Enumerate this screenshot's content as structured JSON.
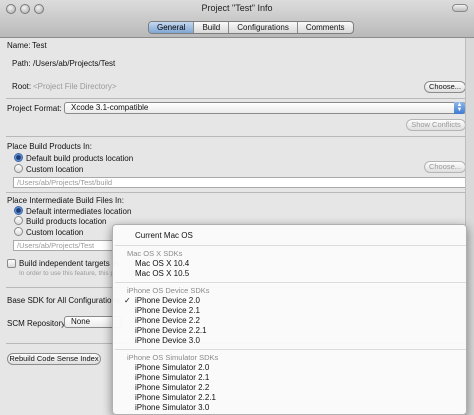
{
  "window": {
    "title": "Project \"Test\" Info",
    "tabs": [
      {
        "label": "General",
        "active": true
      },
      {
        "label": "Build",
        "active": false
      },
      {
        "label": "Configurations",
        "active": false
      },
      {
        "label": "Comments",
        "active": false
      }
    ]
  },
  "general": {
    "name_label": "Name:",
    "name_value": "Test",
    "path_label": "Path:",
    "path_value": "/Users/ab/Projects/Test",
    "root_label": "Root:",
    "root_placeholder": "<Project File Directory>",
    "choose_label": "Choose...",
    "format_label": "Project Format:",
    "format_value": "Xcode 3.1-compatible",
    "show_conflicts_label": "Show Conflicts"
  },
  "build_products": {
    "heading": "Place Build Products In:",
    "default_label": "Default build products location",
    "custom_label": "Custom location",
    "choose_label": "Choose...",
    "path_value": "/Users/ab/Projects/Test/build"
  },
  "intermediates": {
    "heading": "Place Intermediate Build Files In:",
    "default_label": "Default intermediates location",
    "build_products_label": "Build products location",
    "custom_label": "Custom location",
    "path_value": "/Users/ab/Projects/Test",
    "independent_label": "Build independent targets in",
    "independent_note": "In order to use this feature, this p"
  },
  "sdk": {
    "base_label": "Base SDK for All Configurations:",
    "scm_label": "SCM Repository:",
    "scm_value": "None",
    "rebuild_label": "Rebuild Code Sense Index"
  },
  "sdk_menu": {
    "items": [
      {
        "label": "Current Mac OS",
        "type": "item"
      },
      {
        "label": "Mac OS X SDKs",
        "type": "header"
      },
      {
        "label": "Mac OS X 10.4",
        "type": "item"
      },
      {
        "label": "Mac OS X 10.5",
        "type": "item"
      },
      {
        "label": "iPhone OS Device SDKs",
        "type": "header"
      },
      {
        "label": "iPhone Device 2.0",
        "type": "item",
        "checked": true
      },
      {
        "label": "iPhone Device 2.1",
        "type": "item"
      },
      {
        "label": "iPhone Device 2.2",
        "type": "item"
      },
      {
        "label": "iPhone Device 2.2.1",
        "type": "item"
      },
      {
        "label": "iPhone Device 3.0",
        "type": "item"
      },
      {
        "label": "iPhone OS Simulator SDKs",
        "type": "header"
      },
      {
        "label": "iPhone Simulator 2.0",
        "type": "item"
      },
      {
        "label": "iPhone Simulator 2.1",
        "type": "item"
      },
      {
        "label": "iPhone Simulator 2.2",
        "type": "item"
      },
      {
        "label": "iPhone Simulator 2.2.1",
        "type": "item"
      },
      {
        "label": "iPhone Simulator 3.0",
        "type": "item"
      }
    ],
    "checkmark": "✓"
  },
  "colors": {
    "selected_tab": "#7fa6d4",
    "popup_accent": "#3e7ad2"
  }
}
